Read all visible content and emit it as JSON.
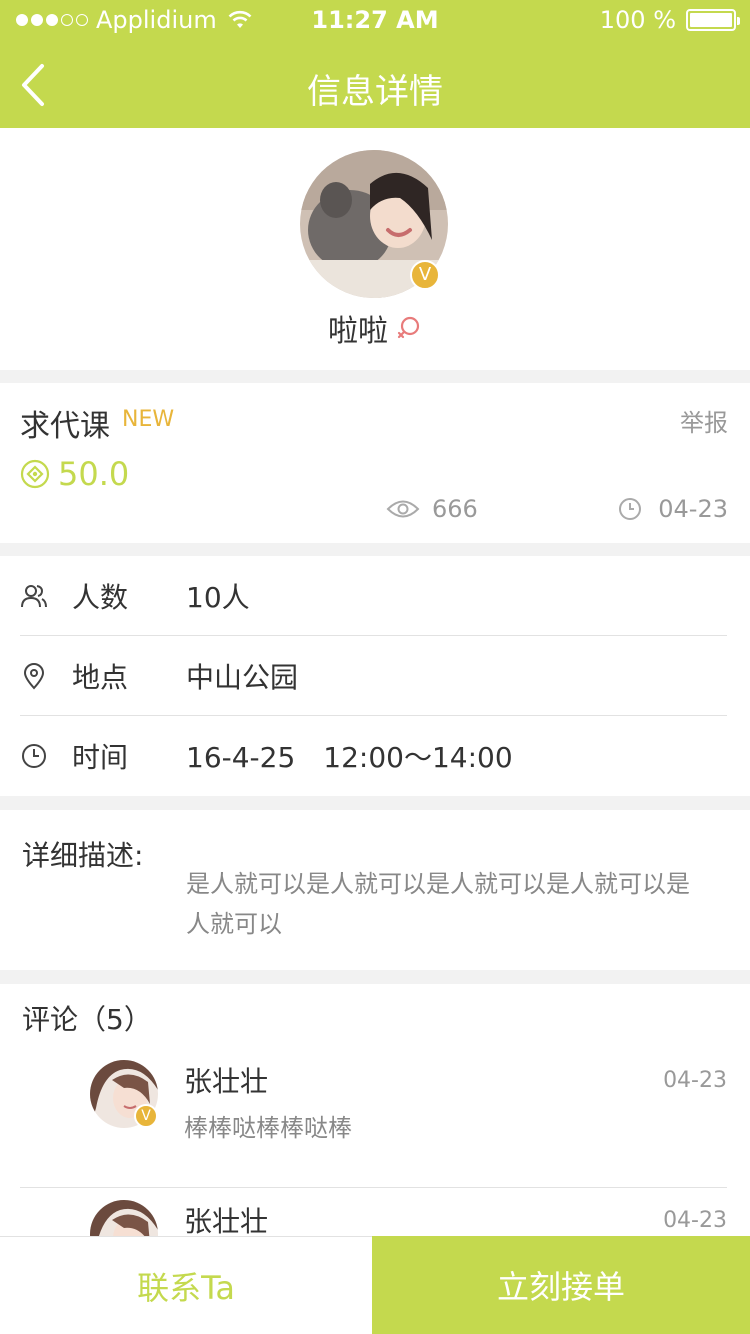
{
  "status_bar": {
    "carrier": "Applidium",
    "time": "11:27 AM",
    "battery": "100 %"
  },
  "nav": {
    "title": "信息详情",
    "back_icon": "chevron-left-icon"
  },
  "profile": {
    "name": "啦啦",
    "verified_badge": "V",
    "gender_icon": "female-icon"
  },
  "task": {
    "title": "求代课",
    "new_tag": "NEW",
    "report": "举报",
    "price": "50.0",
    "views": "666",
    "date": "04-23"
  },
  "details": {
    "people_label": "人数",
    "people_value": "10人",
    "location_label": "地点",
    "location_value": "中山公园",
    "time_label": "时间",
    "time_value": "16-4-25　12:00～14:00"
  },
  "description": {
    "label": "详细描述:",
    "text": "是人就可以是人就可以是人就可以是人就可以是人就可以"
  },
  "comments": {
    "title": "评论（5）",
    "items": [
      {
        "name": "张壮壮",
        "date": "04-23",
        "text": "棒棒哒棒棒哒棒",
        "badge": "V"
      },
      {
        "name": "张壮壮",
        "date": "04-23",
        "text": ""
      }
    ]
  },
  "actions": {
    "contact": "联系Ta",
    "accept": "立刻接单"
  },
  "colors": {
    "accent": "#c4d94e",
    "gold": "#e8b53a",
    "muted": "#999999"
  }
}
